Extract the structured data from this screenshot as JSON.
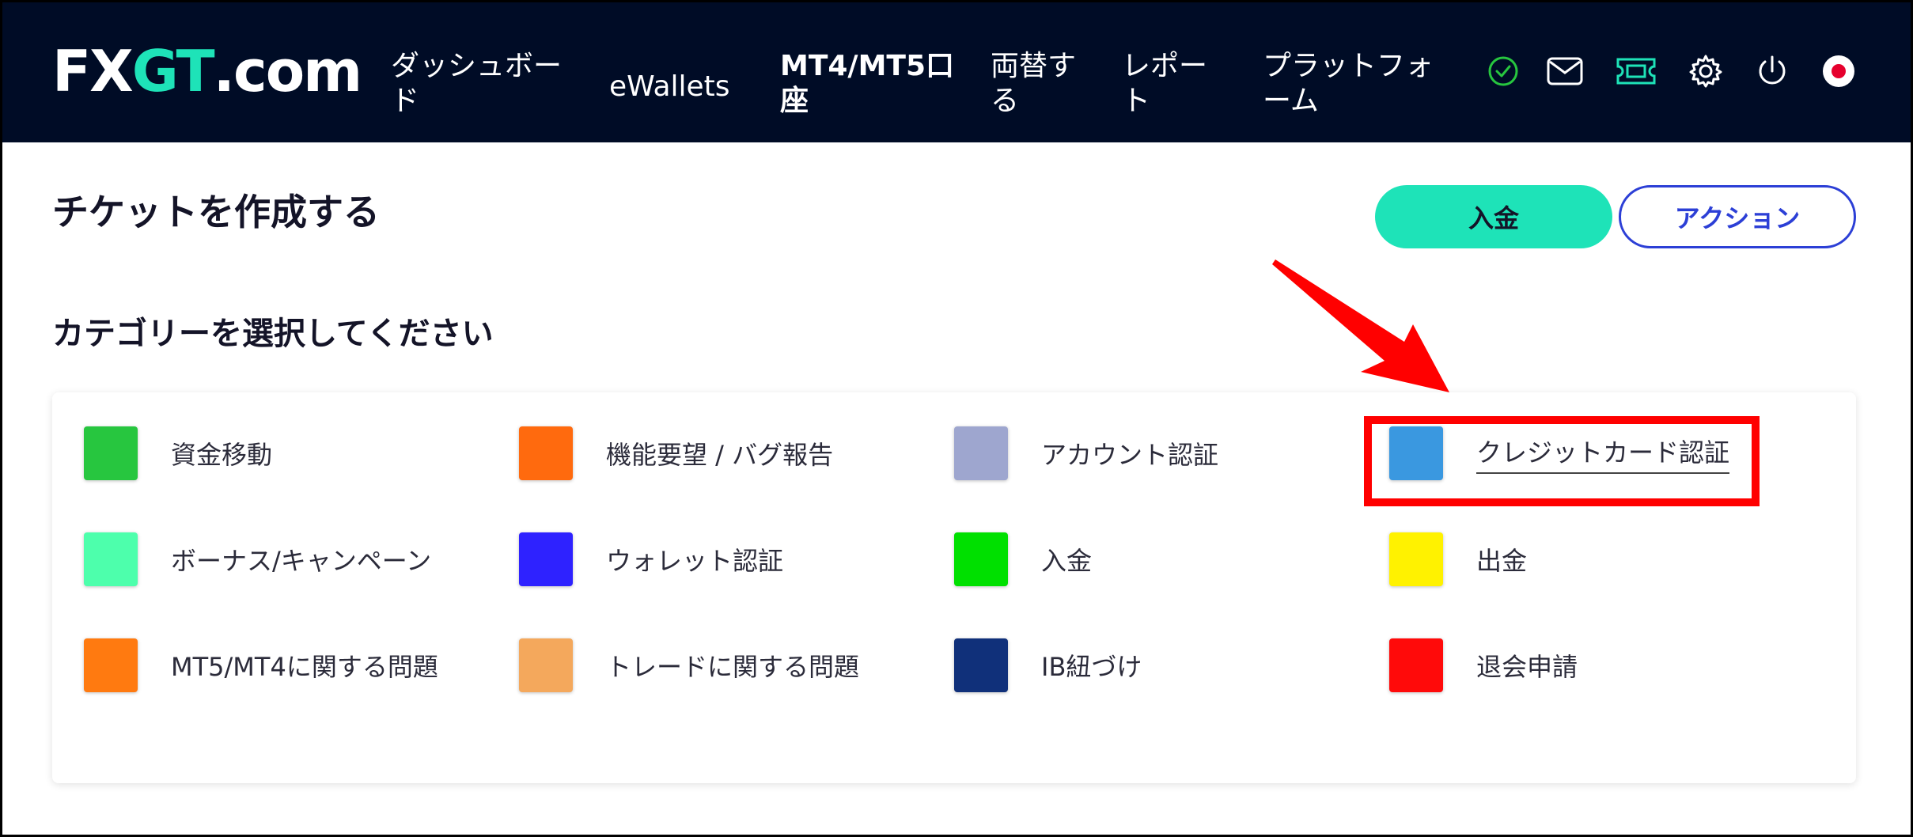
{
  "header": {
    "logo_prefix": "FX",
    "logo_g": "GT",
    "logo_suffix": ".com",
    "nav": [
      {
        "line1": "ダッシュボー",
        "line2": "ド"
      },
      {
        "line1": "eWallets",
        "line2": ""
      },
      {
        "line1": "MT4/MT5口",
        "line2": "座"
      },
      {
        "line1": "両替す",
        "line2": "る"
      },
      {
        "line1": "レポー",
        "line2": "ト"
      },
      {
        "line1": "プラットフォ",
        "line2": "ーム"
      }
    ],
    "icons": [
      "verified-check-icon",
      "mail-icon",
      "ticket-icon",
      "gear-icon",
      "power-icon",
      "language-flag-icon"
    ],
    "accent_color": "#1ee3b8"
  },
  "page": {
    "title": "チケットを作成する",
    "deposit_button": "入金",
    "action_button": "アクション",
    "section_title": "カテゴリーを選択してください"
  },
  "categories": [
    {
      "label": "資金移動",
      "color": "#27c63f"
    },
    {
      "label": "機能要望 / バグ報告",
      "color": "#ff6a0e"
    },
    {
      "label": "アカウント認証",
      "color": "#9ea6cf"
    },
    {
      "label": "クレジットカード認証",
      "color": "#3a98e0"
    },
    {
      "label": "ボーナス/キャンペーン",
      "color": "#4dffac"
    },
    {
      "label": "ウォレット認証",
      "color": "#2e22ff"
    },
    {
      "label": "入金",
      "color": "#00e000"
    },
    {
      "label": "出金",
      "color": "#fff200"
    },
    {
      "label": "MT5/MT4に関する問題",
      "color": "#ff7a10"
    },
    {
      "label": "トレードに関する問題",
      "color": "#f4a85c"
    },
    {
      "label": "IB紐づけ",
      "color": "#10307a"
    },
    {
      "label": "退会申請",
      "color": "#ff0a0a"
    }
  ],
  "annotation": {
    "highlight_color": "#ff0000"
  }
}
